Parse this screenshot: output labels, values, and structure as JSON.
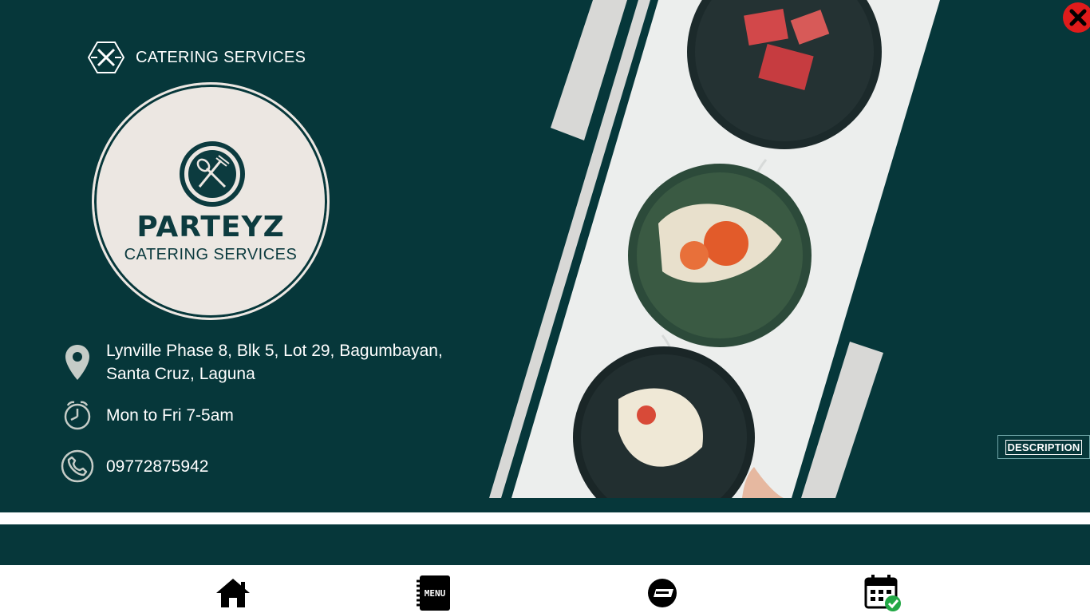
{
  "brand": {
    "label": "CATERING SERVICES",
    "icon": "crossed-utensils-icon"
  },
  "logo": {
    "wordmark": "PARTEYZ",
    "subtitle": "CATERING SERVICES",
    "icon": "spoon-fork-emblem-icon"
  },
  "contact": {
    "address_line1": "Lynville Phase 8, Blk 5, Lot 29, Bagumbayan,",
    "address_line2": "Santa Cruz, Laguna",
    "hours": "Mon to Fri 7-5am",
    "phone": "09772875942"
  },
  "actions": {
    "close_icon": "close-icon",
    "description_label": "DESCRIPTION"
  },
  "nav": [
    {
      "icon": "home-icon"
    },
    {
      "icon": "menu-book-icon",
      "label": "MENU"
    },
    {
      "icon": "reserved-sign-icon"
    },
    {
      "icon": "calendar-check-icon"
    }
  ],
  "colors": {
    "primary": "#06373a",
    "logo_bg": "#ece7e2",
    "close": "#e01b1b"
  }
}
